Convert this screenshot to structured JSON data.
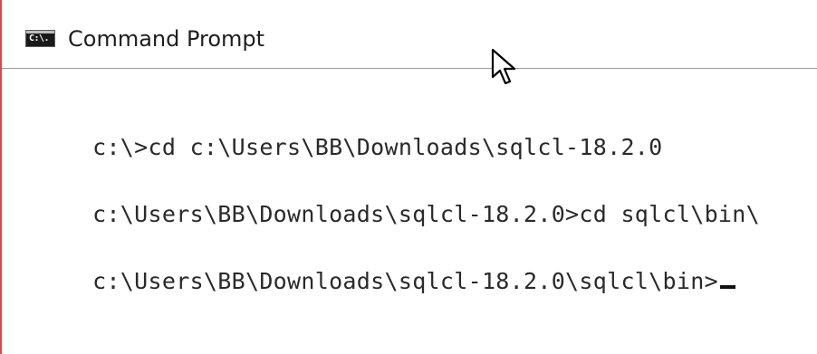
{
  "window": {
    "title": "Command Prompt",
    "icon": {
      "name": "cmd-icon",
      "label": "C:\\."
    }
  },
  "console": {
    "lines": [
      "c:\\>cd c:\\Users\\BB\\Downloads\\sqlcl-18.2.0",
      "c:\\Users\\BB\\Downloads\\sqlcl-18.2.0>cd sqlcl\\bin\\",
      "c:\\Users\\BB\\Downloads\\sqlcl-18.2.0\\sqlcl\\bin>"
    ]
  },
  "pointer": {
    "icon": "mouse-pointer-icon"
  },
  "colors": {
    "window_border": "#d94b4b",
    "title_separator": "#9a9a9a",
    "console_text": "#2a2a2a",
    "background": "#ffffff"
  }
}
